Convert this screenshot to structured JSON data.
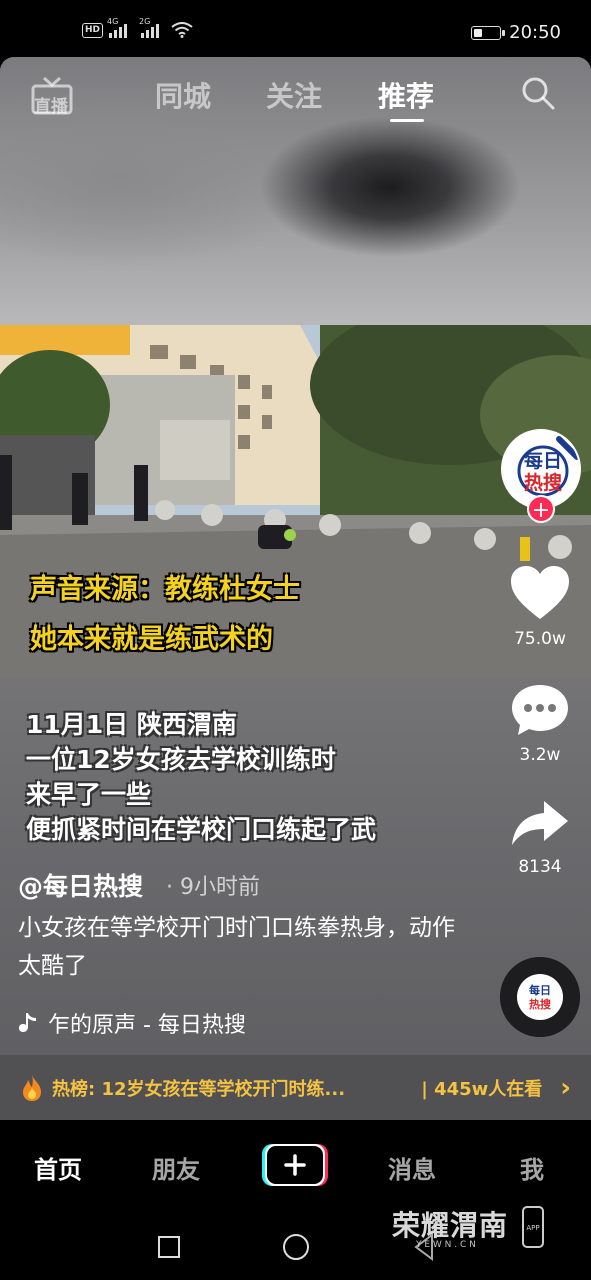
{
  "status_bar": {
    "hd": "HD",
    "net1": "4G",
    "net2": "2G",
    "time": "20:50"
  },
  "top_nav": {
    "live_label": "直播",
    "tabs": [
      "同城",
      "关注",
      "推荐"
    ],
    "active_tab": "推荐"
  },
  "video": {
    "captions": [
      "声音来源：教练杜女士",
      "她本来就是练武术的"
    ],
    "overlay_lines": [
      "11月1日 陕西渭南",
      "一位12岁女孩去学校训练时",
      "来早了一些",
      "便抓紧时间在学校门口练起了武"
    ]
  },
  "rail": {
    "avatar_text": [
      "每日",
      "热搜"
    ],
    "follow": "+",
    "likes": "75.0w",
    "comments": "3.2w",
    "shares": "8134"
  },
  "post": {
    "author": "@每日热搜",
    "time": "· 9小时前",
    "desc": "小女孩在等学校开门时门口练拳热身，动作太酷了",
    "music": "乍的原声 - 每日热搜"
  },
  "hot_bar": {
    "text": "热榜: 12岁女孩在等学校开门时练...",
    "count": "| 445w人在看",
    "chevron": "›"
  },
  "tab_bar": {
    "home": "首页",
    "friends": "朋友",
    "messages": "消息",
    "me": "我"
  },
  "watermark": {
    "title": "荣耀渭南",
    "url": "Y E W N . C N"
  },
  "colors": {
    "caption_yellow": "#f4d21e",
    "follow_red": "#fe2c55",
    "hot_gold": "#f5c242"
  }
}
